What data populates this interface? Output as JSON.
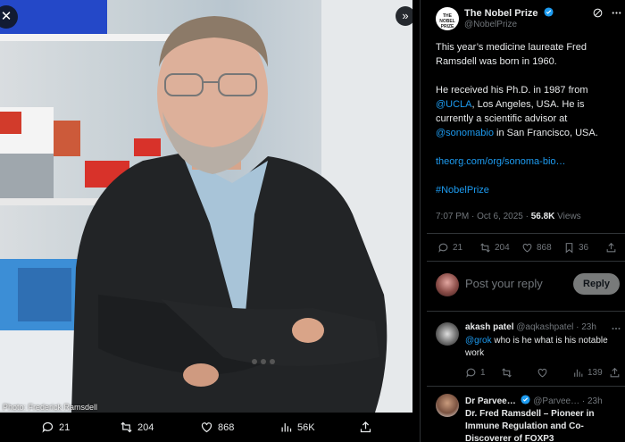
{
  "media": {
    "photo_credit": "Photo: Frederick Ramsdell",
    "close_glyph": "✕",
    "collapse_glyph": "»",
    "actions": {
      "replies": "21",
      "reposts": "204",
      "likes": "868",
      "views": "56K"
    }
  },
  "tweet": {
    "author_name": "The Nobel Prize",
    "author_handle": "@NobelPrize",
    "avatar_text": "THE NOBEL PRIZE",
    "para1": "This year’s medicine laureate Fred Ramsdell was born in 1960.",
    "para2_a": "He received his Ph.D. in 1987 from ",
    "para2_link1": "@UCLA",
    "para2_b": ", Los Angeles, USA. He is currently a scientific advisor at ",
    "para2_link2": "@sonomabio",
    "para2_c": " in San Francisco, USA.",
    "url": "theorg.com/org/sonoma-bio…",
    "hashtag": "#NobelPrize",
    "time": "7:07 PM · Oct 6, 2025 · ",
    "views_count": "56.8K",
    "views_label": " Views",
    "stats": {
      "replies": "21",
      "reposts": "204",
      "likes": "868",
      "bookmarks": "36"
    }
  },
  "reply_box": {
    "placeholder": "Post your reply",
    "button": "Reply"
  },
  "comments": [
    {
      "name": "akash patel",
      "handle": "@aqkashpatel · 23h",
      "mention": "@grok",
      "text": " who is he what is his notable work",
      "replies": "1",
      "views": "139"
    },
    {
      "name": "Dr Parvee…",
      "handle": "@Parvee… · 23h",
      "text": "Dr. Fred Ramsdell – Pioneer in Immune Regulation and Co-Discoverer of FOXP3"
    }
  ],
  "colors": {
    "accent": "#1d9bf0",
    "background": "#000000",
    "muted": "#71767b"
  }
}
